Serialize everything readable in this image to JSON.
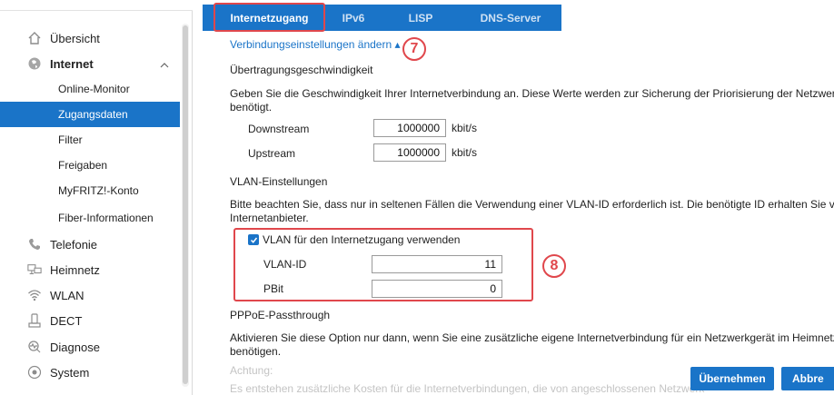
{
  "sidebar": {
    "items": [
      {
        "label": "Übersicht",
        "icon": "home-icon"
      },
      {
        "label": "Internet",
        "icon": "globe-icon"
      },
      {
        "label": "Telefonie",
        "icon": "phone-icon"
      },
      {
        "label": "Heimnetz",
        "icon": "network-icon"
      },
      {
        "label": "WLAN",
        "icon": "wifi-icon"
      },
      {
        "label": "DECT",
        "icon": "dect-phone-icon"
      },
      {
        "label": "Diagnose",
        "icon": "diagnose-icon"
      },
      {
        "label": "System",
        "icon": "system-icon"
      }
    ],
    "internet_sub": [
      {
        "label": "Online-Monitor"
      },
      {
        "label": "Zugangsdaten"
      },
      {
        "label": "Filter"
      },
      {
        "label": "Freigaben"
      },
      {
        "label": "MyFRITZ!-Konto"
      },
      {
        "label": "Fiber-Informationen"
      }
    ]
  },
  "tabs": [
    "Internetzugang",
    "IPv6",
    "LISP",
    "DNS-Server"
  ],
  "content": {
    "link": "Verbindungseinstellungen ändern ▴",
    "badge_7": "7",
    "badge_8": "8",
    "speed_title": "Übertragungsgeschwindigkeit",
    "speed_desc_1": "Geben Sie die Geschwindigkeit Ihrer Internetverbindung an. Diese Werte werden zur Sicherung der Priorisierung der Netzwerkg",
    "speed_desc_2": "benötigt.",
    "downstream_label": "Downstream",
    "downstream_value": "1000000",
    "upstream_label": "Upstream",
    "upstream_value": "1000000",
    "unit": "kbit/s",
    "vlan_title": "VLAN-Einstellungen",
    "vlan_desc_1": "Bitte beachten Sie, dass nur in seltenen Fällen die Verwendung einer VLAN-ID erforderlich ist. Die benötigte ID erhalten Sie von",
    "vlan_desc_2": "Internetanbieter.",
    "vlan_checkbox": "VLAN für den Internetzugang verwenden",
    "vlan_id_label": "VLAN-ID",
    "vlan_id_value": "11",
    "pbit_label": "PBit",
    "pbit_value": "0",
    "pppoe_title": "PPPoE-Passthrough",
    "pppoe_desc_1": "Aktivieren Sie diese Option nur dann, wenn Sie eine zusätzliche eigene Internetverbindung für ein Netzwerkgerät im Heimnetz",
    "pppoe_desc_2": "benötigen.",
    "warning_title": "Achtung:",
    "warning_text": "Es entstehen zusätzliche Kosten für die Internetverbindungen, die von angeschlossenen Netzwerk"
  },
  "buttons": {
    "apply": "Übernehmen",
    "cancel": "Abbre"
  },
  "colors": {
    "accent": "#1a74c8",
    "highlight": "#e0474c"
  }
}
